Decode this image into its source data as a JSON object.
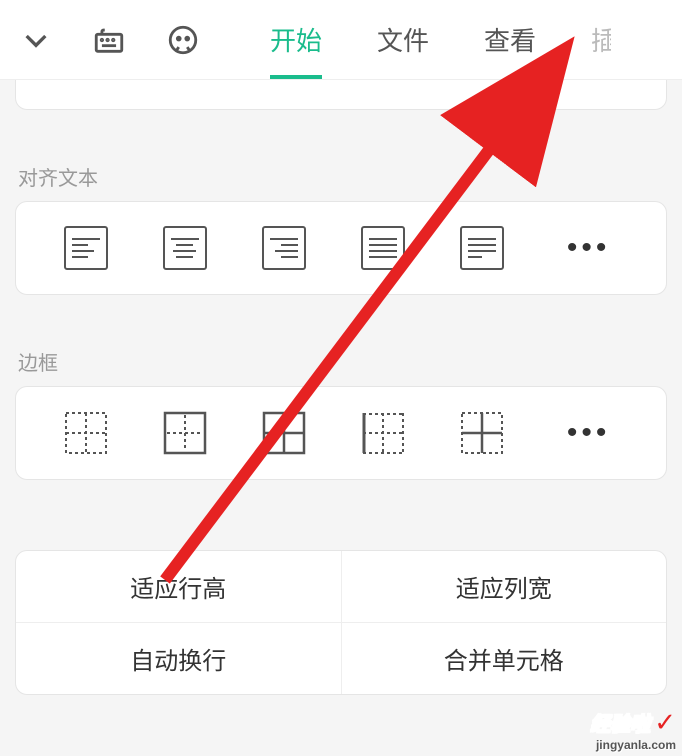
{
  "header": {
    "tabs": {
      "start": "开始",
      "file": "文件",
      "view": "查看",
      "partial": "插"
    }
  },
  "sections": {
    "align": {
      "label": "对齐文本"
    },
    "border": {
      "label": "边框"
    }
  },
  "buttons": {
    "fit_row": "适应行高",
    "fit_col": "适应列宽",
    "wrap": "自动换行",
    "merge": "合并单元格"
  },
  "watermark": {
    "brand": "经验啦",
    "url": "jingyanla.com"
  }
}
